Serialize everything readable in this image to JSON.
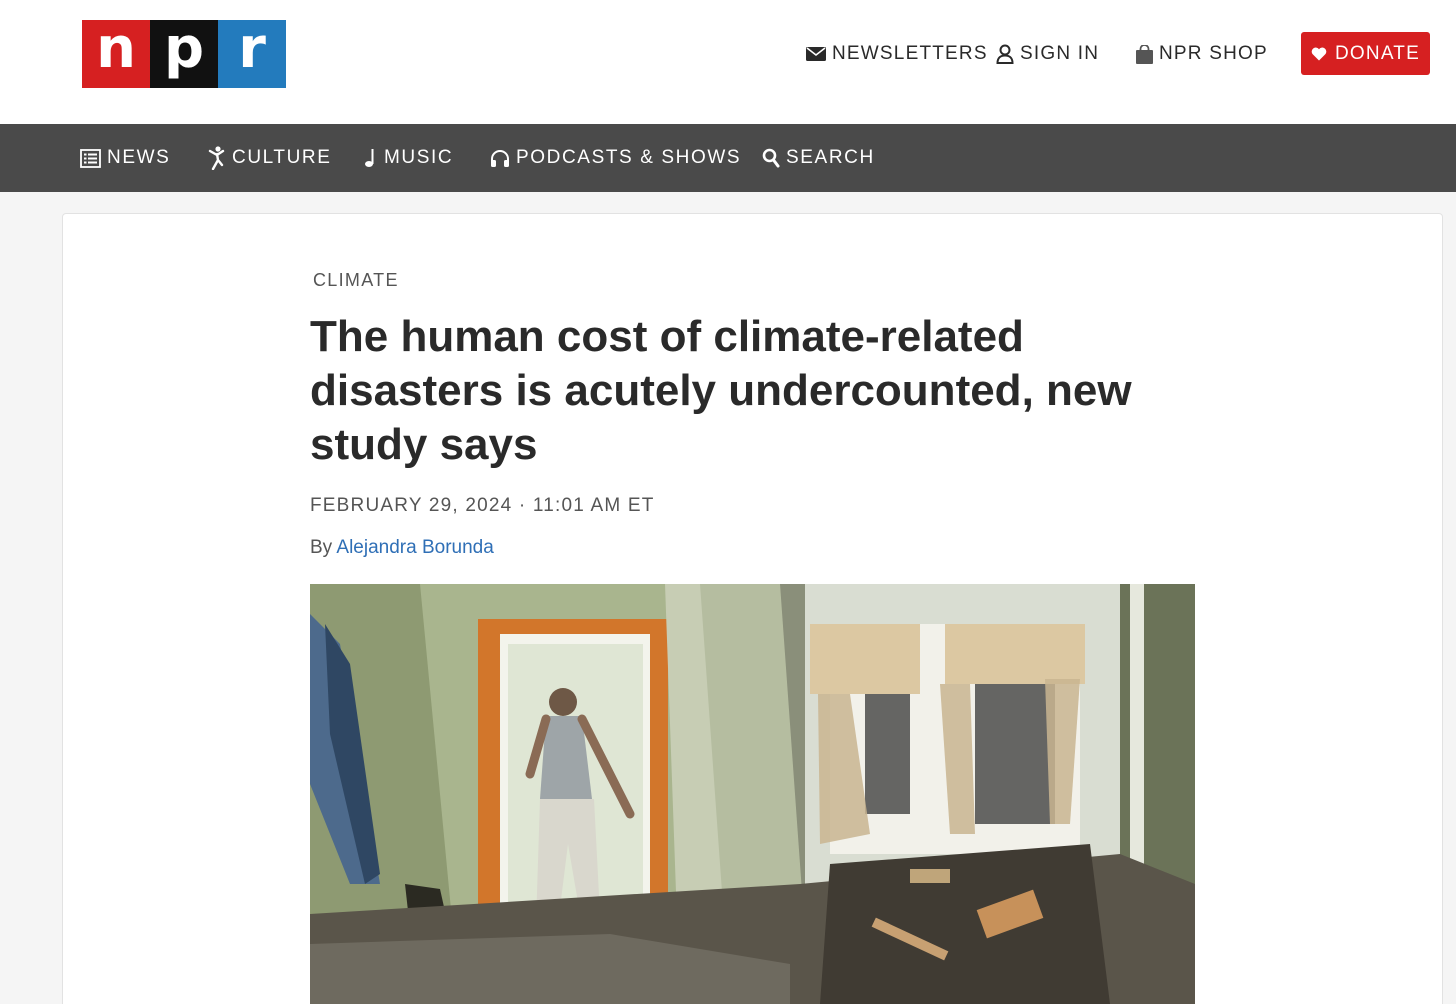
{
  "header": {
    "logo": {
      "letters": [
        "n",
        "p",
        "r"
      ]
    },
    "utility": {
      "newsletters": "NEWSLETTERS",
      "sign_in": "SIGN IN",
      "shop": "NPR SHOP",
      "donate": "DONATE"
    }
  },
  "nav": {
    "items": [
      {
        "label": "NEWS",
        "icon": "news-list-icon"
      },
      {
        "label": "CULTURE",
        "icon": "dancer-icon"
      },
      {
        "label": "MUSIC",
        "icon": "music-note-icon"
      },
      {
        "label": "PODCASTS & SHOWS",
        "icon": "headphones-icon"
      },
      {
        "label": "SEARCH",
        "icon": "search-icon"
      }
    ]
  },
  "article": {
    "section": "CLIMATE",
    "headline": "The human cost of climate-related disasters is acutely undercounted, new study says",
    "dateline": "FEBRUARY 29, 2024 · 11:01 AM ET",
    "byline_prefix": "By ",
    "author": "Alejandra Borunda"
  },
  "colors": {
    "brand_red": "#d62021",
    "brand_black": "#111111",
    "brand_blue": "#237bbd",
    "nav_bg": "#4a4a4a",
    "link": "#2f6fb6"
  }
}
